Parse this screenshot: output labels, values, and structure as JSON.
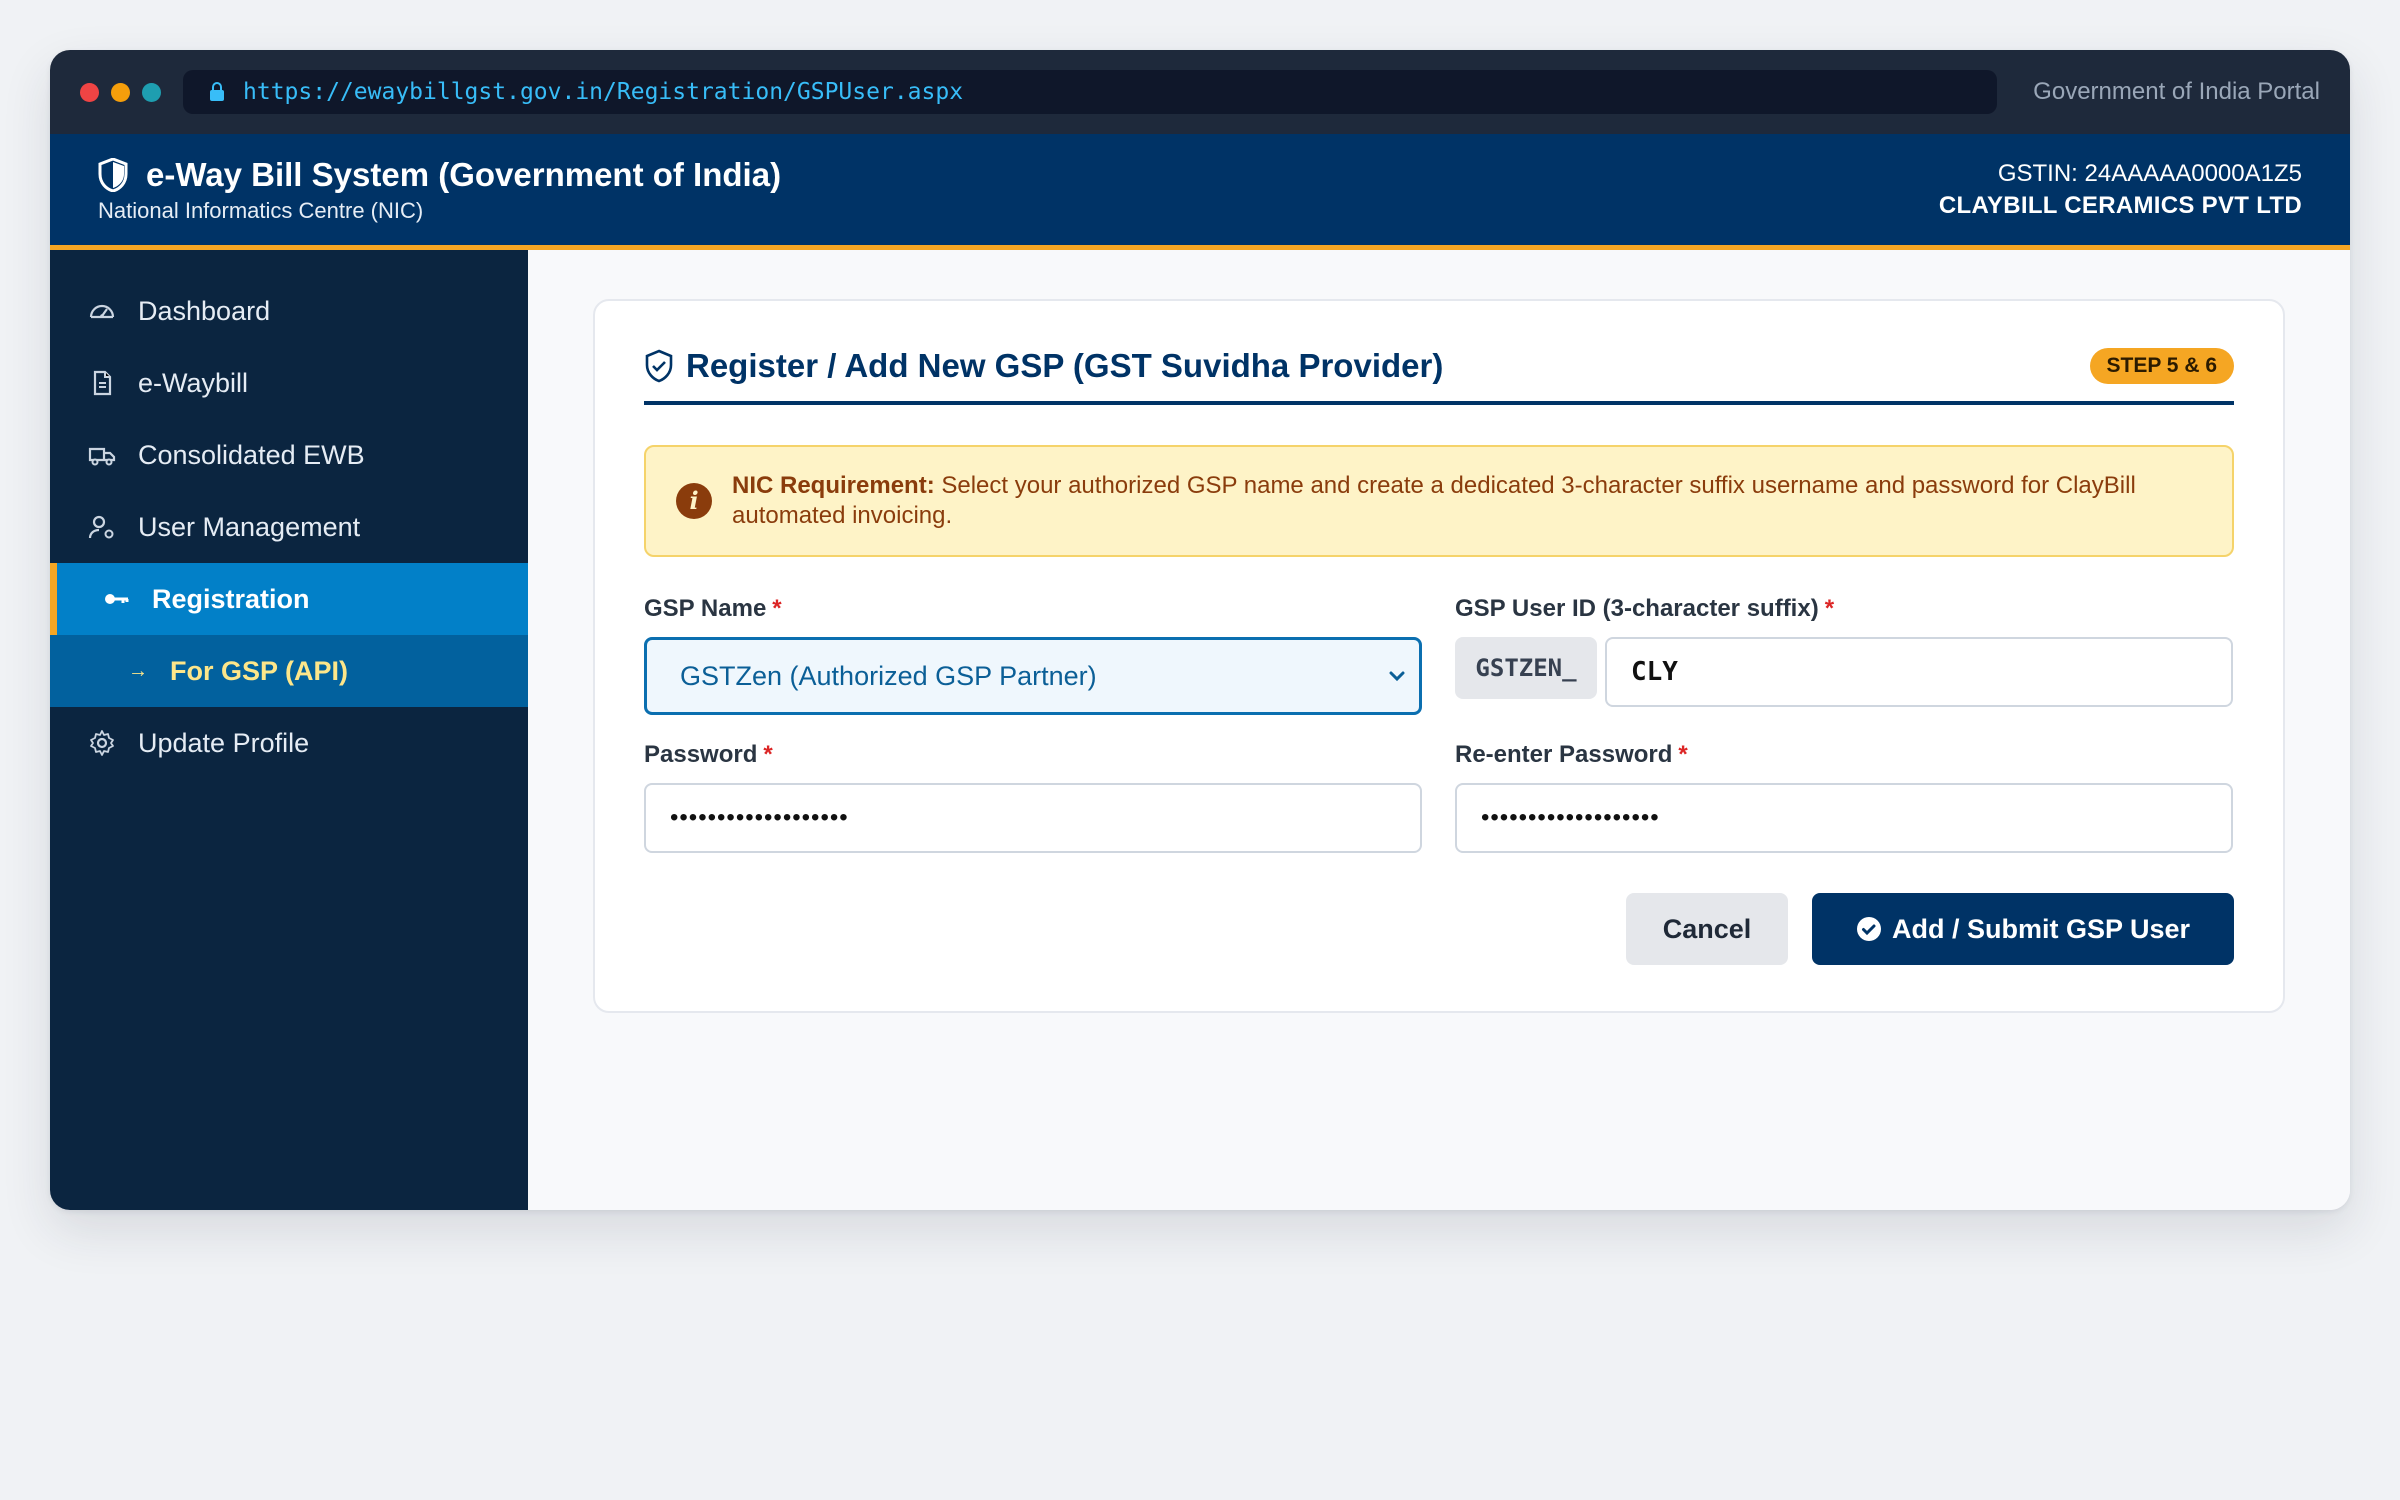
{
  "browser": {
    "url": "https://ewaybillgst.gov.in/Registration/GSPUser.aspx",
    "right_label": "Government of India Portal",
    "dot_colors": [
      "#ef4444",
      "#f59e0b",
      "#1e9eb0"
    ]
  },
  "header": {
    "title": "e-Way Bill System (Government of India)",
    "subtitle": "National Informatics Centre (NIC)",
    "gstin": "GSTIN: 24AAAAA0000A1Z5",
    "company": "CLAYBILL CERAMICS PVT LTD",
    "logo_icon": "shield-icon"
  },
  "sidebar": {
    "items": [
      {
        "label": "Dashboard",
        "icon": "gauge-icon"
      },
      {
        "label": "e-Waybill",
        "icon": "document-icon"
      },
      {
        "label": "Consolidated EWB",
        "icon": "truck-icon"
      },
      {
        "label": "User Management",
        "icon": "user-gear-icon"
      },
      {
        "label": "Registration",
        "icon": "key-icon"
      },
      {
        "label": "For GSP (API)",
        "icon": "arrow-right-icon"
      },
      {
        "label": "Update Profile",
        "icon": "gear-icon"
      }
    ]
  },
  "form": {
    "title": "Register / Add New GSP (GST Suvidha Provider)",
    "step_badge": "STEP 5 & 6",
    "notice_bold": "NIC Requirement:",
    "notice_text": " Select your authorized GSP name and create a dedicated 3-character suffix username and password for ClayBill automated invoicing.",
    "gsp_name_label": "GSP Name",
    "gsp_name_value": "GSTZen (Authorized GSP Partner)",
    "user_id_label": "GSP User ID (3-character suffix)",
    "user_id_prefix": "GSTZEN_",
    "user_id_value": "CLY",
    "password_label": "Password",
    "password_value": "•••••••••••••••••••",
    "repassword_label": "Re-enter Password",
    "repassword_value": "•••••••••••••••••••",
    "required_mark": "*",
    "cancel_label": "Cancel",
    "submit_label": "Add / Submit GSP User"
  },
  "colors": {
    "primary": "#003366",
    "accent": "#f5a623",
    "active_nav": "#0280c8",
    "required": "#dc2626"
  }
}
